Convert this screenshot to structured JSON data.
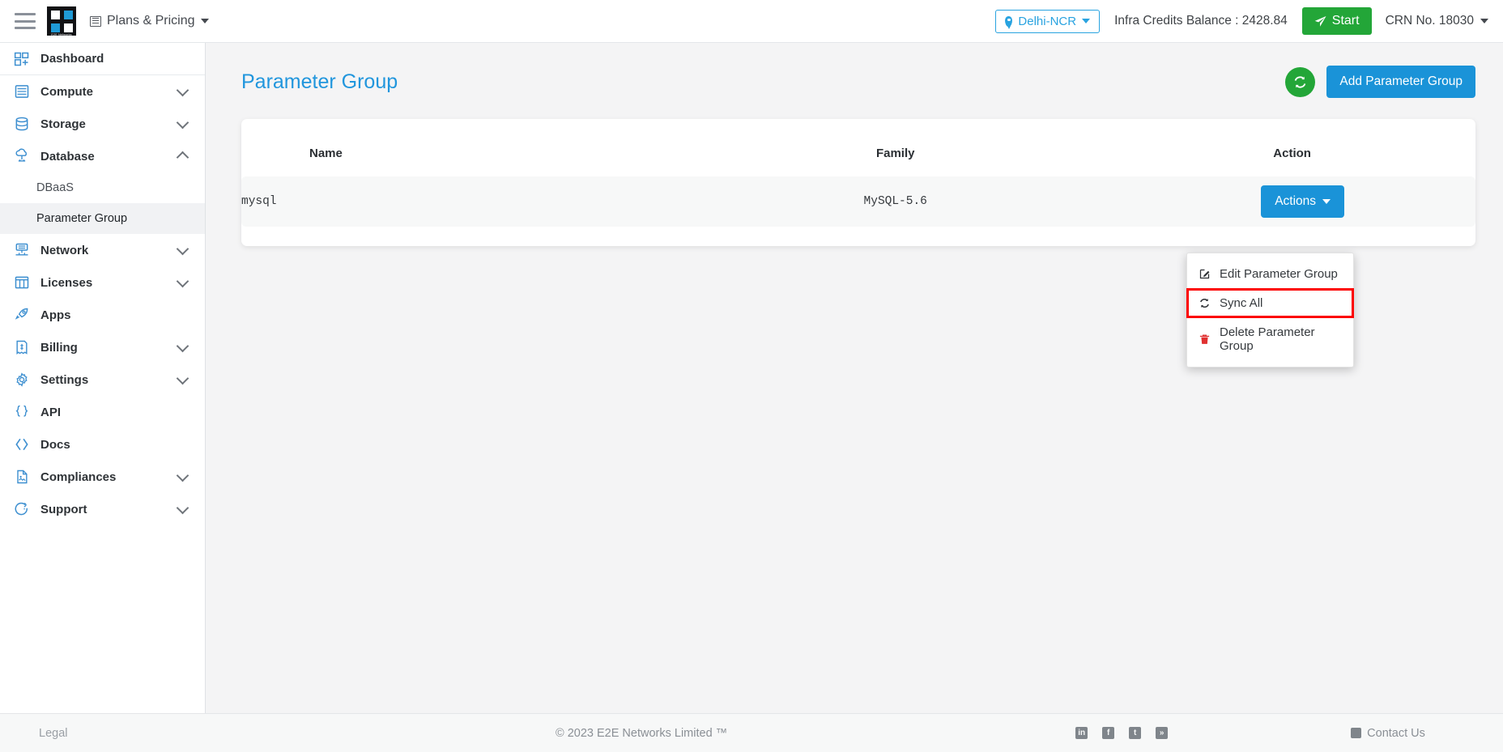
{
  "topbar": {
    "menu_icon": "hamburger-icon",
    "logo_caption": "E2E Networks",
    "plans_label": "Plans & Pricing",
    "plans_icon": "list-icon",
    "region": "Delhi-NCR",
    "region_icon": "location-pin-icon",
    "credits_label": "Infra Credits Balance : 2428.84",
    "start_label": "Start",
    "start_icon": "paper-plane-icon",
    "crn_label": "CRN No. 18030"
  },
  "sidebar": {
    "items": [
      {
        "label": "Dashboard",
        "icon": "dashboard-icon",
        "expandable": false,
        "expanded": false
      },
      {
        "label": "Compute",
        "icon": "server-icon",
        "expandable": true,
        "expanded": false
      },
      {
        "label": "Storage",
        "icon": "database-icon",
        "expandable": true,
        "expanded": false
      },
      {
        "label": "Database",
        "icon": "cloud-db-icon",
        "expandable": true,
        "expanded": true
      },
      {
        "label": "Network",
        "icon": "network-icon",
        "expandable": true,
        "expanded": false
      },
      {
        "label": "Licenses",
        "icon": "license-icon",
        "expandable": true,
        "expanded": false
      },
      {
        "label": "Apps",
        "icon": "rocket-icon",
        "expandable": false,
        "expanded": false
      },
      {
        "label": "Billing",
        "icon": "invoice-icon",
        "expandable": true,
        "expanded": false
      },
      {
        "label": "Settings",
        "icon": "gear-icon",
        "expandable": true,
        "expanded": false
      },
      {
        "label": "API",
        "icon": "braces-icon",
        "expandable": false,
        "expanded": false
      },
      {
        "label": "Docs",
        "icon": "code-icon",
        "expandable": false,
        "expanded": false
      },
      {
        "label": "Compliances",
        "icon": "document-icon",
        "expandable": true,
        "expanded": false
      },
      {
        "label": "Support",
        "icon": "support-icon",
        "expandable": true,
        "expanded": false
      }
    ],
    "database_subitems": [
      {
        "label": "DBaaS",
        "active": false
      },
      {
        "label": "Parameter Group",
        "active": true
      }
    ]
  },
  "main": {
    "page_title": "Parameter Group",
    "refresh_icon": "sync-refresh-icon",
    "add_button_label": "Add Parameter Group",
    "table": {
      "columns": [
        "Name",
        "Family",
        "Action"
      ],
      "rows": [
        {
          "name": "mysql",
          "family": "MySQL-5.6",
          "action_label": "Actions"
        }
      ]
    },
    "dropdown": {
      "open": true,
      "items": [
        {
          "label": "Edit Parameter Group",
          "icon": "edit-pencil-icon",
          "highlighted": false,
          "danger": false
        },
        {
          "label": "Sync All",
          "icon": "sync-refresh-icon",
          "highlighted": true,
          "danger": false
        },
        {
          "label": "Delete Parameter Group",
          "icon": "trash-icon",
          "highlighted": false,
          "danger": true
        }
      ],
      "highlight_color": "#fc0000"
    }
  },
  "footer": {
    "legal_label": "Legal",
    "copyright": "© 2023 E2E Networks Limited ™",
    "social": [
      {
        "name": "linkedin-icon",
        "glyph": "in"
      },
      {
        "name": "facebook-icon",
        "glyph": "f"
      },
      {
        "name": "twitter-icon",
        "glyph": "t"
      },
      {
        "name": "rss-icon",
        "glyph": "»"
      }
    ],
    "contact_label": "Contact Us",
    "contact_icon": "phone-icon"
  },
  "colors": {
    "accent_blue": "#1a93d8",
    "title_blue": "#2196dd",
    "green": "#23a638",
    "danger_red": "#e03131",
    "highlight_red": "#fc0000"
  }
}
